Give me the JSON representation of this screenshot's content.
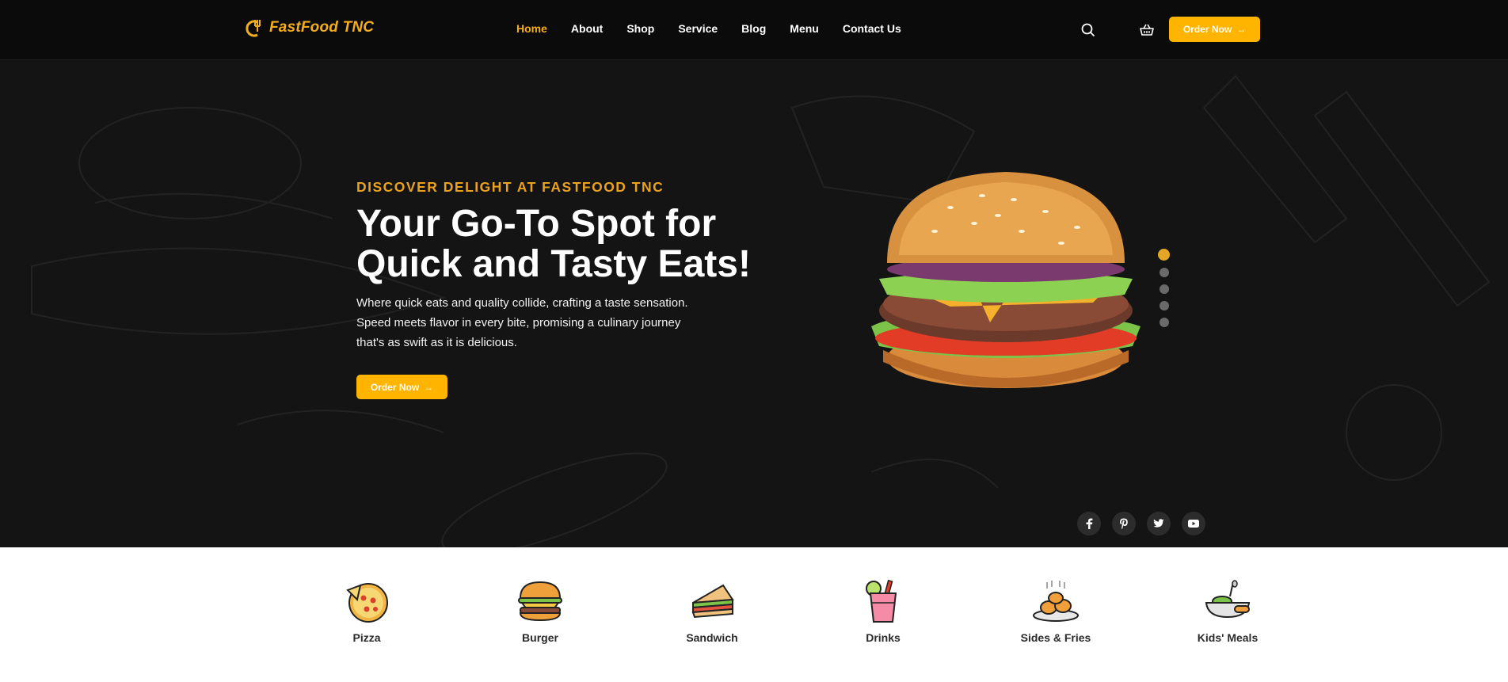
{
  "header": {
    "logo_text": "FastFood TNC",
    "nav": [
      "Home",
      "About",
      "Shop",
      "Service",
      "Blog",
      "Menu",
      "Contact Us"
    ],
    "active_nav": "Home",
    "order_label": "Order Now",
    "arrow": "→"
  },
  "hero": {
    "eyebrow": "DISCOVER DELIGHT AT FASTFOOD TNC",
    "headline_line1": "Your Go-To Spot for",
    "headline_line2": "Quick and Tasty Eats!",
    "description": "Where quick eats and quality collide, crafting a taste sensation. Speed meets flavor in every bite, promising a culinary journey that's as swift as it is delicious.",
    "button_label": "Order Now",
    "slide_count": 5,
    "active_slide": 1
  },
  "socials": [
    "facebook-icon",
    "pinterest-icon",
    "twitter-icon",
    "youtube-icon"
  ],
  "categories": [
    "Pizza",
    "Burger",
    "Sandwich",
    "Drinks",
    "Sides & Fries",
    "Kids' Meals"
  ],
  "colors": {
    "accent": "#ffb400",
    "heading_accent": "#eaa21f",
    "dark_bg": "#141414"
  }
}
